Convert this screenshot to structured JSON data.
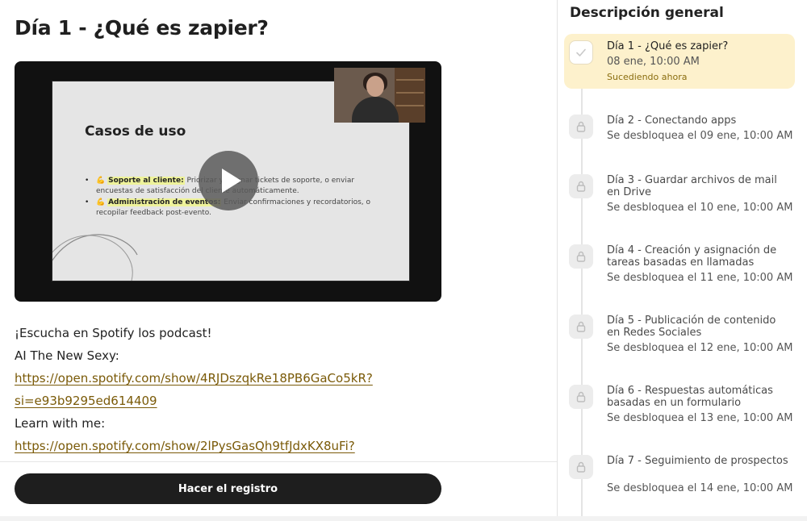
{
  "lesson": {
    "title": "Día 1 - ¿Qué es zapier?"
  },
  "video": {
    "slide_title": "Casos de uso",
    "bullets": [
      {
        "emoji": "💪",
        "highlight": "Soporte al cliente:",
        "text": " Priorizar y asignar tickets de soporte, o enviar encuestas de satisfacción del cliente automáticamente."
      },
      {
        "emoji": "💪",
        "highlight": "Administración de eventos:",
        "text": " Enviar confirmaciones y recordatorios, o recopilar feedback post-evento."
      }
    ]
  },
  "description": {
    "lines": [
      {
        "type": "text",
        "value": "¡Escucha en Spotify los podcast!"
      },
      {
        "type": "text",
        "value": "AI The New Sexy:"
      },
      {
        "type": "link",
        "value": "https://open.spotify.com/show/4RJDszqkRe18PB6GaCo5kR?"
      },
      {
        "type": "link",
        "value": "si=e93b9295ed614409"
      },
      {
        "type": "text",
        "value": "Learn with me:"
      },
      {
        "type": "link",
        "value": "https://open.spotify.com/show/2lPysGasQh9tfJdxKX8uFi?"
      }
    ]
  },
  "cta": {
    "label": "Hacer el registro"
  },
  "sidebar": {
    "title": "Descripción general",
    "items": [
      {
        "title": "Día 1 - ¿Qué es zapier?",
        "date": "08 ene, 10:00 AM",
        "status": "Sucediendo ahora",
        "icon": "check-icon",
        "active": true
      },
      {
        "title": "Día 2 - Conectando apps",
        "date": "Se desbloquea el 09 ene, 10:00 AM",
        "icon": "lock-icon"
      },
      {
        "title": "Día 3 - Guardar archivos de mail en Drive",
        "date": "Se desbloquea el 10 ene, 10:00 AM",
        "icon": "lock-icon"
      },
      {
        "title": "Día 4 - Creación y asignación de tareas basadas en llamadas",
        "date": "Se desbloquea el 11 ene, 10:00 AM",
        "icon": "lock-icon"
      },
      {
        "title": "Día 5 - Publicación de contenido en Redes Sociales",
        "date": "Se desbloquea el 12 ene, 10:00 AM",
        "icon": "lock-icon"
      },
      {
        "title": "Día 6 - Respuestas automáticas basadas en un formulario",
        "date": "Se desbloquea el 13 ene, 10:00 AM",
        "icon": "lock-icon"
      },
      {
        "title": "Día 7 - Seguimiento de prospectos",
        "date": "Se desbloquea el 14 ene, 10:00 AM",
        "icon": "lock-icon"
      }
    ]
  },
  "colors": {
    "active_bg": "#fdf1cc",
    "link": "#7a5a08",
    "status": "#8a6d0f",
    "cta_bg": "#1e1e1e"
  }
}
